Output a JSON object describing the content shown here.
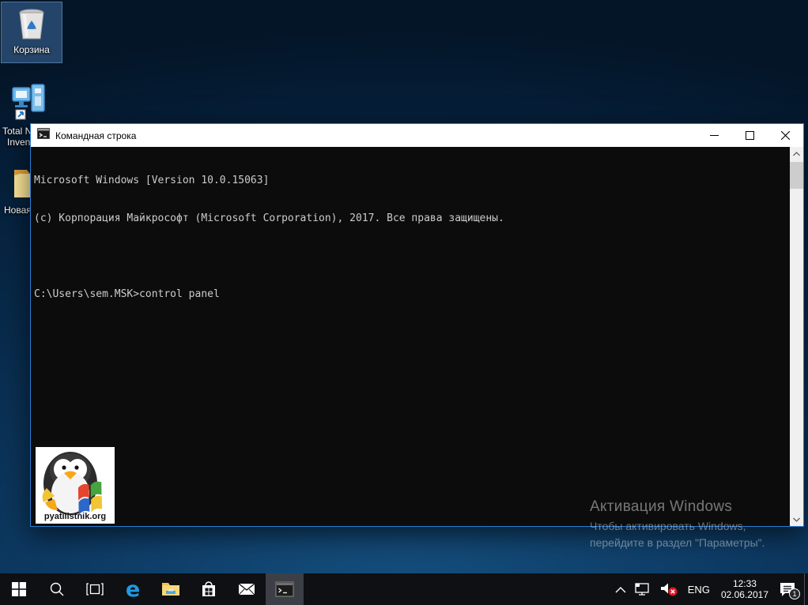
{
  "desktop": {
    "icons": {
      "recycle_bin": {
        "label": "Корзина"
      },
      "total_network_inventory": {
        "label_line1": "Total N",
        "label_line2": "Inven"
      },
      "new_folder": {
        "label": "Новая"
      }
    }
  },
  "window": {
    "title": "Командная строка",
    "console": {
      "lines": [
        "Microsoft Windows [Version 10.0.15063]",
        "(c) Корпорация Майкрософт (Microsoft Corporation), 2017. Все права защищены.",
        "",
        "C:\\Users\\sem.MSK>control panel"
      ]
    },
    "logo": {
      "site": "pyatilistnik.org"
    }
  },
  "watermark": {
    "title": "Активация Windows",
    "line2": "Чтобы активировать Windows,",
    "line3": "перейдите в раздел \"Параметры\"."
  },
  "taskbar": {
    "language": "ENG",
    "time": "12:33",
    "date": "02.06.2017",
    "notification_count": "1"
  },
  "colors": {
    "accent_border": "#2b7cd3",
    "console_bg": "#0c0c0c",
    "console_fg": "#cccccc",
    "taskbar_bg": "#0f1013",
    "edge_blue": "#1e9be2",
    "mute_red": "#e81123"
  }
}
